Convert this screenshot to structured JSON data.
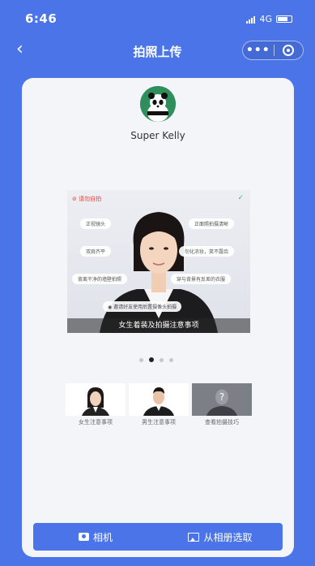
{
  "status_bar": {
    "time": "6:46",
    "network": "4G"
  },
  "nav": {
    "title": "拍照上传"
  },
  "user": {
    "name": "Super Kelly"
  },
  "banner": {
    "warning": "请勿自拍",
    "tips": [
      "正视镜头",
      "正面照拍摄清晰",
      "双肩齐平",
      "勿化浓妆，笑不露齿",
      "背离干净的墙壁拍照",
      "穿与背景有反差的衣服"
    ],
    "camera_tip": "邀请好友使用后置摄像头拍摄",
    "caption": "女生着装及拍摄注意事项"
  },
  "carousel": {
    "page_count": 4,
    "active_index": 1
  },
  "tiles": [
    {
      "label": "女生注意事项"
    },
    {
      "label": "男生注意事项"
    },
    {
      "label": "查看拍摄技巧"
    }
  ],
  "actions": {
    "camera_label": "相机",
    "album_label": "从相册选取"
  },
  "colors": {
    "primary": "#4a74e8",
    "card": "#f4f5f9",
    "warning": "#e0453b",
    "ok": "#34c26e"
  }
}
